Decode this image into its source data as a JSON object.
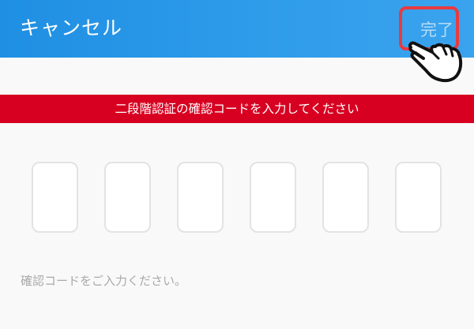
{
  "header": {
    "cancel_label": "キャンセル",
    "done_label": "完了"
  },
  "banner": {
    "text": "二段階認証の確認コードを入力してください"
  },
  "code_input": {
    "digits": [
      "",
      "",
      "",
      "",
      "",
      ""
    ]
  },
  "hint": {
    "text": "確認コードをご入力ください。"
  },
  "colors": {
    "header": "#2f9cea",
    "banner": "#d80021",
    "highlight": "#e83a3f",
    "done_text": "#b7dcf6"
  },
  "icons": {
    "pointer": "pointing-hand-icon"
  }
}
